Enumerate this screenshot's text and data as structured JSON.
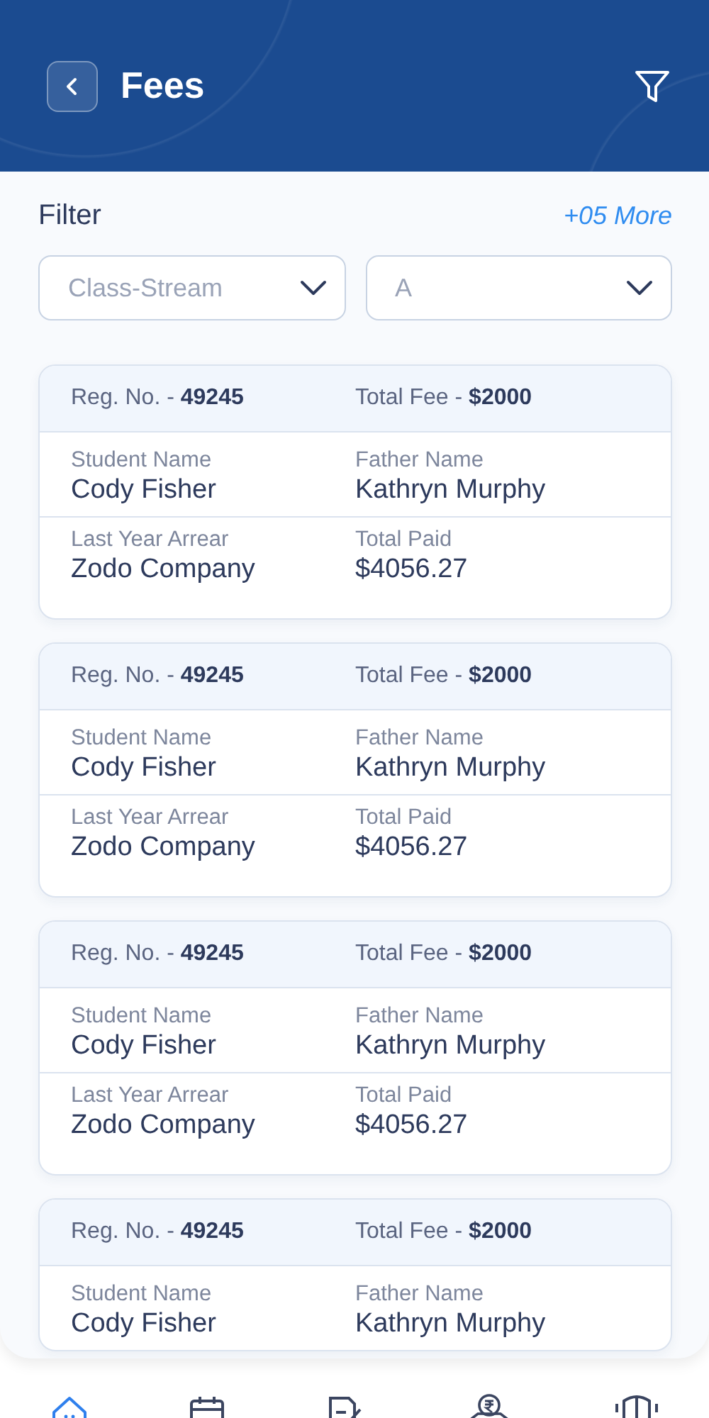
{
  "header": {
    "title": "Fees"
  },
  "filter": {
    "label": "Filter",
    "more": "+05 More",
    "dropdowns": [
      {
        "placeholder": "Class-Stream"
      },
      {
        "placeholder": "A"
      }
    ]
  },
  "cards": [
    {
      "reg_label": "Reg. No. -",
      "reg_value": "49245",
      "fee_label": "Total Fee  -",
      "fee_value": "$2000",
      "rows": [
        [
          {
            "label": "Student Name",
            "value": "Cody Fisher"
          },
          {
            "label": "Father Name",
            "value": "Kathryn Murphy"
          }
        ],
        [
          {
            "label": "Last Year Arrear",
            "value": "Zodo Company"
          },
          {
            "label": "Total Paid",
            "value": "$4056.27"
          }
        ]
      ]
    },
    {
      "reg_label": "Reg. No. -",
      "reg_value": "49245",
      "fee_label": "Total Fee  -",
      "fee_value": "$2000",
      "rows": [
        [
          {
            "label": "Student Name",
            "value": "Cody Fisher"
          },
          {
            "label": "Father Name",
            "value": "Kathryn Murphy"
          }
        ],
        [
          {
            "label": "Last Year Arrear",
            "value": "Zodo Company"
          },
          {
            "label": "Total Paid",
            "value": "$4056.27"
          }
        ]
      ]
    },
    {
      "reg_label": "Reg. No. -",
      "reg_value": "49245",
      "fee_label": "Total Fee  -",
      "fee_value": "$2000",
      "rows": [
        [
          {
            "label": "Student Name",
            "value": "Cody Fisher"
          },
          {
            "label": "Father Name",
            "value": "Kathryn Murphy"
          }
        ],
        [
          {
            "label": "Last Year Arrear",
            "value": "Zodo Company"
          },
          {
            "label": "Total Paid",
            "value": "$4056.27"
          }
        ]
      ]
    },
    {
      "reg_label": "Reg. No. -",
      "reg_value": "49245",
      "fee_label": "Total Fee  -",
      "fee_value": "$2000",
      "rows": [
        [
          {
            "label": "Student Name",
            "value": "Cody Fisher"
          },
          {
            "label": "Father Name",
            "value": "Kathryn Murphy"
          }
        ]
      ]
    }
  ],
  "nav": [
    {
      "kind": "home",
      "selected": true
    },
    {
      "kind": "calendar",
      "selected": false
    },
    {
      "kind": "edit",
      "selected": false
    },
    {
      "kind": "payment",
      "selected": false
    },
    {
      "kind": "school",
      "selected": false
    }
  ]
}
